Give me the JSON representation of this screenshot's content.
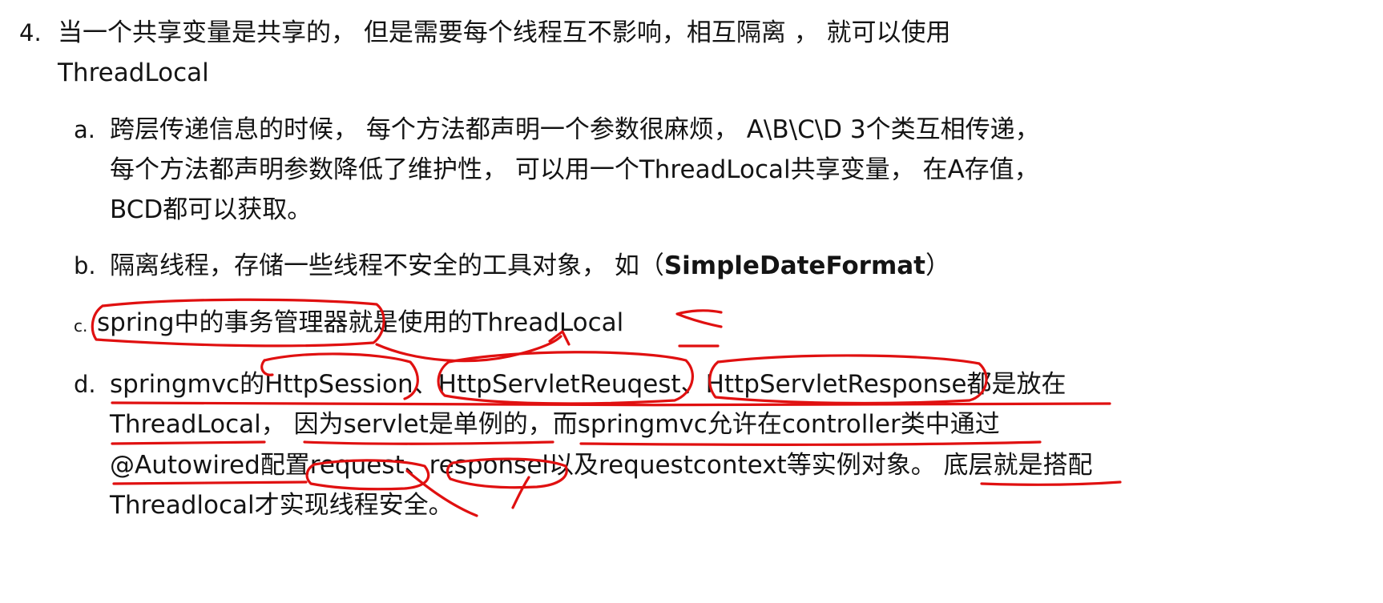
{
  "item4": {
    "marker": "4.",
    "line1": "当一个共享变量是共享的， 但是需要每个线程互不影响，相互隔离 ， 就可以使用",
    "line2": "ThreadLocal"
  },
  "item_a": {
    "marker": "a.",
    "line1": "跨层传递信息的时候， 每个方法都声明一个参数很麻烦， A\\B\\C\\D 3个类互相传递，",
    "line2": "每个方法都声明参数降低了维护性， 可以用一个ThreadLocal共享变量， 在A存值，",
    "line3": "BCD都可以获取。"
  },
  "item_b": {
    "marker": "b.",
    "text": "隔离线程，存储一些线程不安全的工具对象， 如（",
    "bold": "SimpleDateFormat",
    "close": "）"
  },
  "item_c": {
    "marker": "c.",
    "text": "spring中的事务管理器就是使用的ThreadLocal"
  },
  "item_d": {
    "marker": "d.",
    "line1": "springmvc的HttpSession、HttpServletReuqest、HttpServletResponse都是放在",
    "line2": "ThreadLocal， 因为servlet是单例的，而springmvc允许在controller类中通过",
    "line3": "@Autowired配置request、responsel以及requestcontext等实例对象。 底层就是搭配",
    "line4": "Threadlocal才实现线程安全。"
  },
  "annotation_color": "#e01010"
}
